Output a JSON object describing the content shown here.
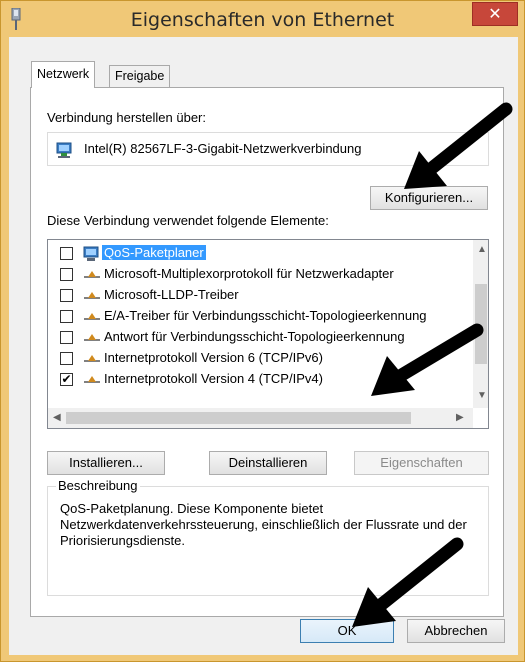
{
  "window": {
    "title": "Eigenschaften von Ethernet",
    "close_label": "✕"
  },
  "tabs": [
    {
      "label": "Netzwerk",
      "active": true
    },
    {
      "label": "Freigabe",
      "active": false
    }
  ],
  "connect_via": {
    "label": "Verbindung herstellen über:",
    "adapter": "Intel(R) 82567LF-3-Gigabit-Netzwerkverbindung",
    "configure_button": "Konfigurieren..."
  },
  "items_section": {
    "label": "Diese Verbindung verwendet folgende Elemente:",
    "items": [
      {
        "label": "QoS-Paketplaner",
        "checked": false,
        "selected": true,
        "icon": "network-computer-icon"
      },
      {
        "label": "Microsoft-Multiplexorprotokoll für Netzwerkadapter",
        "checked": false,
        "selected": false,
        "icon": "protocol-icon"
      },
      {
        "label": "Microsoft-LLDP-Treiber",
        "checked": false,
        "selected": false,
        "icon": "protocol-icon"
      },
      {
        "label": "E/A-Treiber für Verbindungsschicht-Topologieerkennung",
        "checked": false,
        "selected": false,
        "icon": "protocol-icon"
      },
      {
        "label": "Antwort für Verbindungsschicht-Topologieerkennung",
        "checked": false,
        "selected": false,
        "icon": "protocol-icon"
      },
      {
        "label": "Internetprotokoll Version 6 (TCP/IPv6)",
        "checked": false,
        "selected": false,
        "icon": "protocol-icon"
      },
      {
        "label": "Internetprotokoll Version 4 (TCP/IPv4)",
        "checked": true,
        "selected": false,
        "icon": "protocol-icon"
      }
    ]
  },
  "buttons": {
    "install": "Installieren...",
    "uninstall": "Deinstallieren",
    "properties": "Eigenschaften",
    "ok": "OK",
    "cancel": "Abbrechen"
  },
  "description": {
    "title": "Beschreibung",
    "text": "QoS-Paketplanung. Diese Komponente bietet Netzwerkdatenverkehrssteuerung, einschließlich der Flussrate und der Priorisierungsdienste."
  },
  "colors": {
    "title_bar": "#f0c877",
    "close_button": "#c7473a",
    "selection": "#3399ff",
    "annotation_arrows": "#000000"
  }
}
